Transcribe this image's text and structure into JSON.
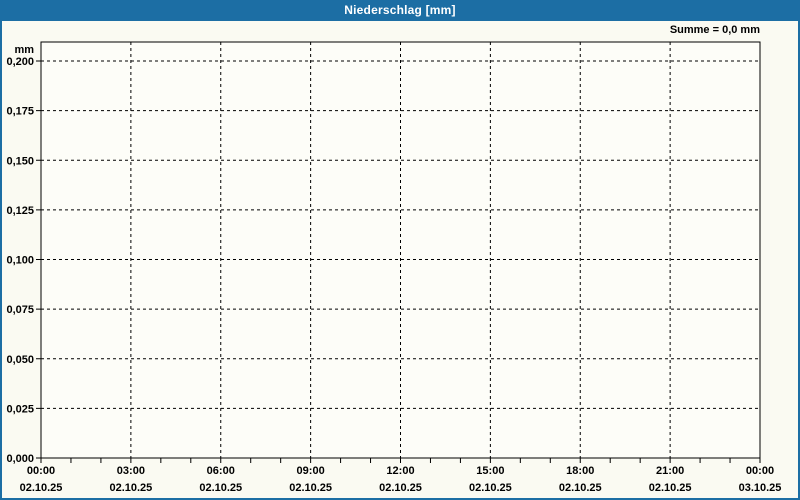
{
  "window": {
    "title": "Niederschlag [mm]"
  },
  "colors": {
    "accent_blue": "#1C6EA4",
    "title_text": "#FFFFFF",
    "background": "#FAFAF2",
    "plot_background": "#FDFDF8",
    "grid": "#000000",
    "text": "#000000"
  },
  "chart_data": {
    "type": "bar",
    "title": "Niederschlag [mm]",
    "unit": "mm",
    "xlabel": "",
    "ylabel": "mm",
    "annotation": "Summe = 0,0 mm",
    "sum_mm": 0.0,
    "ylim": [
      0.0,
      0.2
    ],
    "ytick_step": 0.025,
    "y_ticks": [
      "0,000",
      "0,025",
      "0,050",
      "0,075",
      "0,100",
      "0,125",
      "0,150",
      "0,175",
      "0,200"
    ],
    "x_ticks": [
      {
        "time": "00:00",
        "date": "02.10.25"
      },
      {
        "time": "03:00",
        "date": "02.10.25"
      },
      {
        "time": "06:00",
        "date": "02.10.25"
      },
      {
        "time": "09:00",
        "date": "02.10.25"
      },
      {
        "time": "12:00",
        "date": "02.10.25"
      },
      {
        "time": "15:00",
        "date": "02.10.25"
      },
      {
        "time": "18:00",
        "date": "02.10.25"
      },
      {
        "time": "21:00",
        "date": "02.10.25"
      },
      {
        "time": "00:00",
        "date": "03.10.25"
      }
    ],
    "minor_ticks_per_major_interval": 2,
    "grid": true,
    "grid_style": "dashed",
    "legend": "none",
    "series": [
      {
        "name": "Niederschlag",
        "values": []
      }
    ]
  }
}
